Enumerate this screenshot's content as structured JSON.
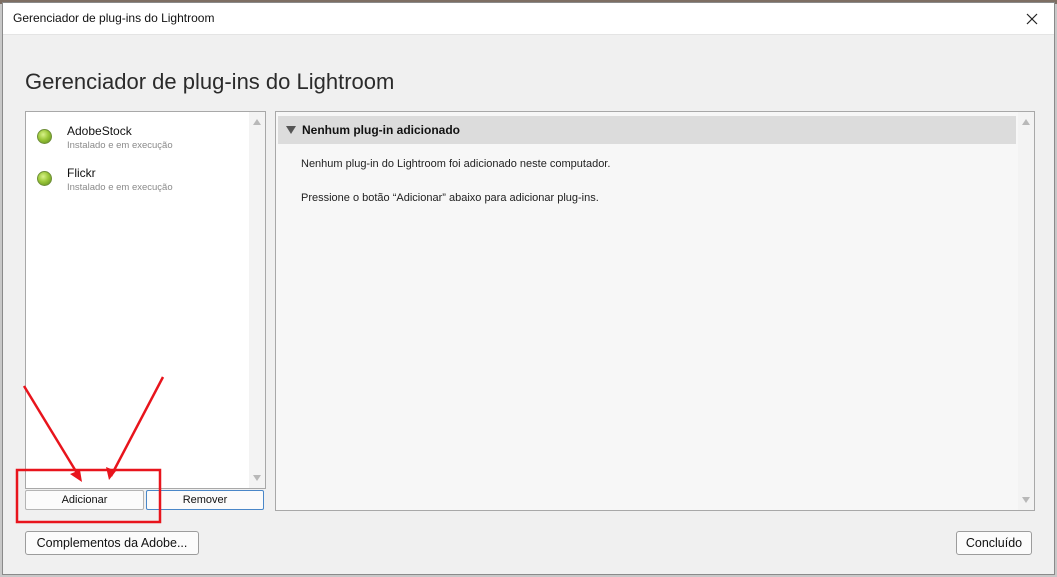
{
  "window": {
    "title": "Gerenciador de plug-ins do Lightroom",
    "heading": "Gerenciador de plug-ins do Lightroom"
  },
  "plugins": [
    {
      "name": "AdobeStock",
      "status": "Instalado e em execução",
      "status_color": "#8cc63f"
    },
    {
      "name": "Flickr",
      "status": "Instalado e em execução",
      "status_color": "#8cc63f"
    }
  ],
  "list_buttons": {
    "add_label": "Adicionar",
    "remove_label": "Remover"
  },
  "details": {
    "section_title": "Nenhum plug-in adicionado",
    "message_1": "Nenhum plug-in do Lightroom foi adicionado neste computador.",
    "message_2": "Pressione o botão “Adicionar” abaixo para adicionar plug-ins."
  },
  "footer": {
    "adobe_button_label": "Complementos da Adobe...",
    "done_button_label": "Concluído"
  },
  "annotation": {
    "color": "#e8141c"
  }
}
